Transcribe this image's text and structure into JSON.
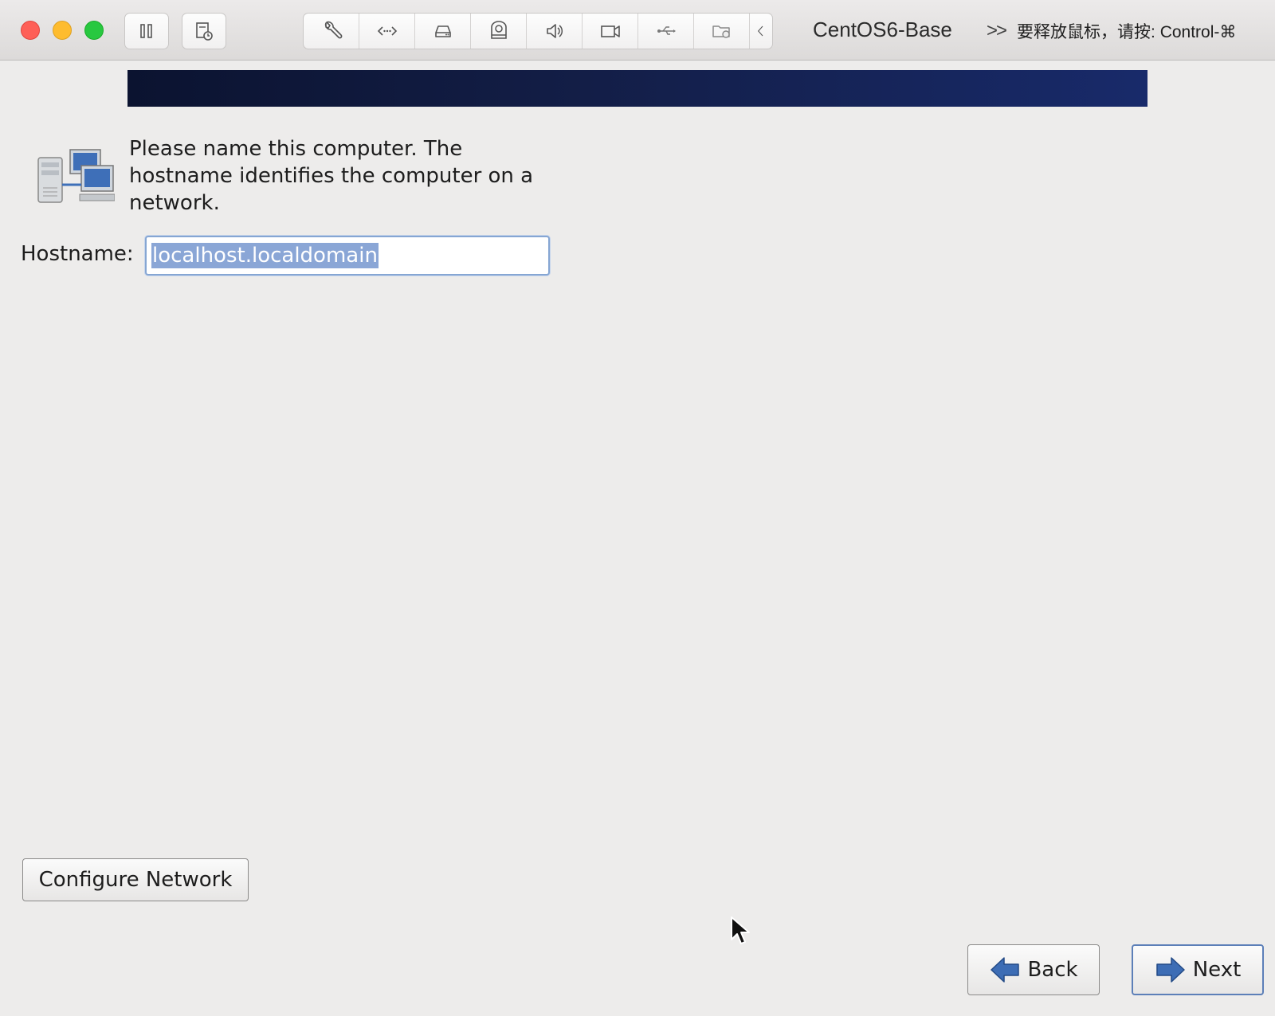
{
  "window": {
    "vm_title": "CentOS6-Base",
    "release_hint_chevron": ">>",
    "release_hint": "要释放鼠标，请按: Control-⌘"
  },
  "toolbar": {
    "icons": [
      "pause-icon",
      "snapshot-icon",
      "wrench-icon",
      "network-arrows-icon",
      "hard-disk-icon",
      "optical-drive-icon",
      "speaker-icon",
      "camera-icon",
      "usb-icon",
      "shared-folder-icon",
      "chevron-left-icon"
    ]
  },
  "content": {
    "intro": "Please name this computer.  The hostname identifies the computer on a network.",
    "hostname_label": "Hostname:",
    "hostname_value": "localhost.localdomain"
  },
  "buttons": {
    "configure_network": "Configure Network",
    "back": "Back",
    "next": "Next"
  },
  "colors": {
    "banner_start": "#0b1330",
    "banner_end": "#182a6a",
    "selection": "#8aa6d6",
    "arrow_blue": "#3d6db5"
  }
}
